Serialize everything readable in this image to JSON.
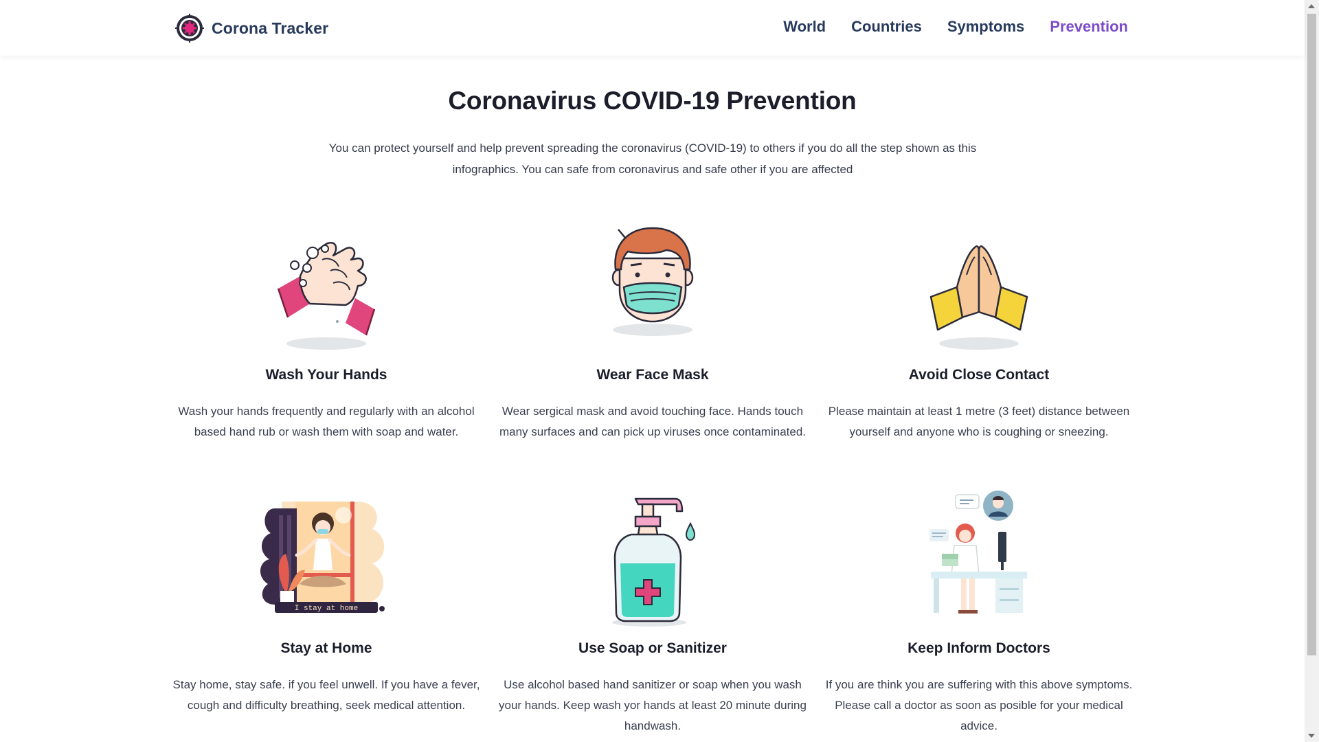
{
  "brand": {
    "name": "Corona Tracker",
    "logo_icon": "virus-target-icon"
  },
  "nav": {
    "items": [
      {
        "label": "World",
        "active": false
      },
      {
        "label": "Countries",
        "active": false
      },
      {
        "label": "Symptoms",
        "active": false
      },
      {
        "label": "Prevention",
        "active": true
      }
    ]
  },
  "main": {
    "title": "Coronavirus COVID-19 Prevention",
    "intro": "You can protect yourself and help prevent spreading the coronavirus (COVID-19) to others if you do all the step shown as this infographics. You can safe from coronavirus and safe other if you are affected",
    "cards": [
      {
        "title": "Wash Your Hands",
        "text": "Wash your hands frequently and regularly with an alcohol based hand rub or wash them with soap and water.",
        "illustration": "washing-hands-illustration"
      },
      {
        "title": "Wear Face Mask",
        "text": "Wear sergical mask and avoid touching face. Hands touch many surfaces and can pick up viruses once contaminated.",
        "illustration": "face-mask-illustration"
      },
      {
        "title": "Avoid Close Contact",
        "text": "Please maintain at least 1 metre (3 feet) distance between yourself and anyone who is coughing or sneezing.",
        "illustration": "praying-hands-illustration"
      },
      {
        "title": "Stay at Home",
        "text": "Stay home, stay safe. if you feel unwell. If you have a fever, cough and difficulty breathing, seek medical attention.",
        "illustration": "stay-home-illustration",
        "illustration_caption": "I stay at home"
      },
      {
        "title": "Use Soap or Sanitizer",
        "text": "Use alcohol based hand sanitizer or soap when you wash your hands. Keep wash yor hands at least 20 minute during handwash.",
        "illustration": "sanitizer-bottle-illustration"
      },
      {
        "title": "Keep Inform Doctors",
        "text": "If you are think you are suffering with this above symptoms. Please call a doctor as soon as posible for your medical advice.",
        "illustration": "doctor-call-illustration"
      }
    ]
  },
  "colors": {
    "brand_text": "#273a5c",
    "active_nav": "#7c4bc9",
    "title_text": "#1b1e2a"
  }
}
